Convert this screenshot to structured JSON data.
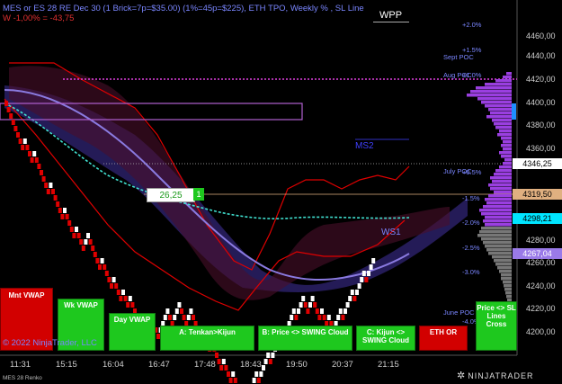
{
  "header": {
    "title": "MES or ES 28 RE Dec 30 (1 Brick=7p=$35.00) (1%=45p=$225), ETH TPO, Weekly % , SL Line",
    "sl_line": "W -1,00% = -43,75",
    "wpp_label": "WPP"
  },
  "copyright": "© 2022 NinjaTrader, LLC",
  "instrument_footer": "MES 28 Renko",
  "brand": "NINJATRADER",
  "price_axis": {
    "labels": [
      "4460,00",
      "4440,00",
      "4420,00",
      "4400,00",
      "4380,00",
      "4360,00",
      "4280,00",
      "4260,00",
      "4240,00",
      "4220,00",
      "4200,00"
    ]
  },
  "price_tags": [
    {
      "value": "4346,25",
      "bg": "#ffffff",
      "fg": "#000000"
    },
    {
      "value": "4319,50",
      "bg": "#e0b080",
      "fg": "#000000"
    },
    {
      "value": "4298,21",
      "bg": "#00e5ff",
      "fg": "#000000"
    },
    {
      "value": "4267,04",
      "bg": "#9a7ae8",
      "fg": "#ffffff"
    }
  ],
  "percent_levels": [
    "+2.0%",
    "+1.5%",
    "+1.0%",
    "+0.5%",
    "-1.5%",
    "-2.0%",
    "-2.5%",
    "-3.0%",
    "-4.0%"
  ],
  "poc_labels": [
    "Sept POC",
    "Aug POC",
    "July POC",
    "June POC"
  ],
  "chart_labels": {
    "ms2": "MS2",
    "ws1": "WS1",
    "price_box": "26,25",
    "price_box_count": "1"
  },
  "time_axis": [
    "11:31",
    "15:15",
    "16:04",
    "16:47",
    "17:48",
    "18:43",
    "19:50",
    "20:37",
    "21:15"
  ],
  "signal_buttons": [
    {
      "label": "Mnt VWAP",
      "color": "#d20000"
    },
    {
      "label": "Wk VWAP",
      "color": "#1ec81e"
    },
    {
      "label": "Day VWAP",
      "color": "#1ec81e"
    },
    {
      "label": "A: Tenkan>Kijun",
      "color": "#1ec81e"
    },
    {
      "label": "B: Price <> SWING Cloud",
      "color": "#1ec81e"
    },
    {
      "label": "C: Kijun <> SWING Cloud",
      "color": "#1ec81e"
    },
    {
      "label": "ETH OR",
      "color": "#d20000"
    },
    {
      "label": "Price <> SL Lines Cross",
      "color": "#1ec81e"
    }
  ],
  "colors": {
    "bull_brick": "#ffffff",
    "bear_brick": "#e00000",
    "profile": "#9a3fe0",
    "cloud": "#3a2a7a",
    "cyan_ma": "#40e0d0",
    "slow_ma": "#8a7ae0"
  }
}
